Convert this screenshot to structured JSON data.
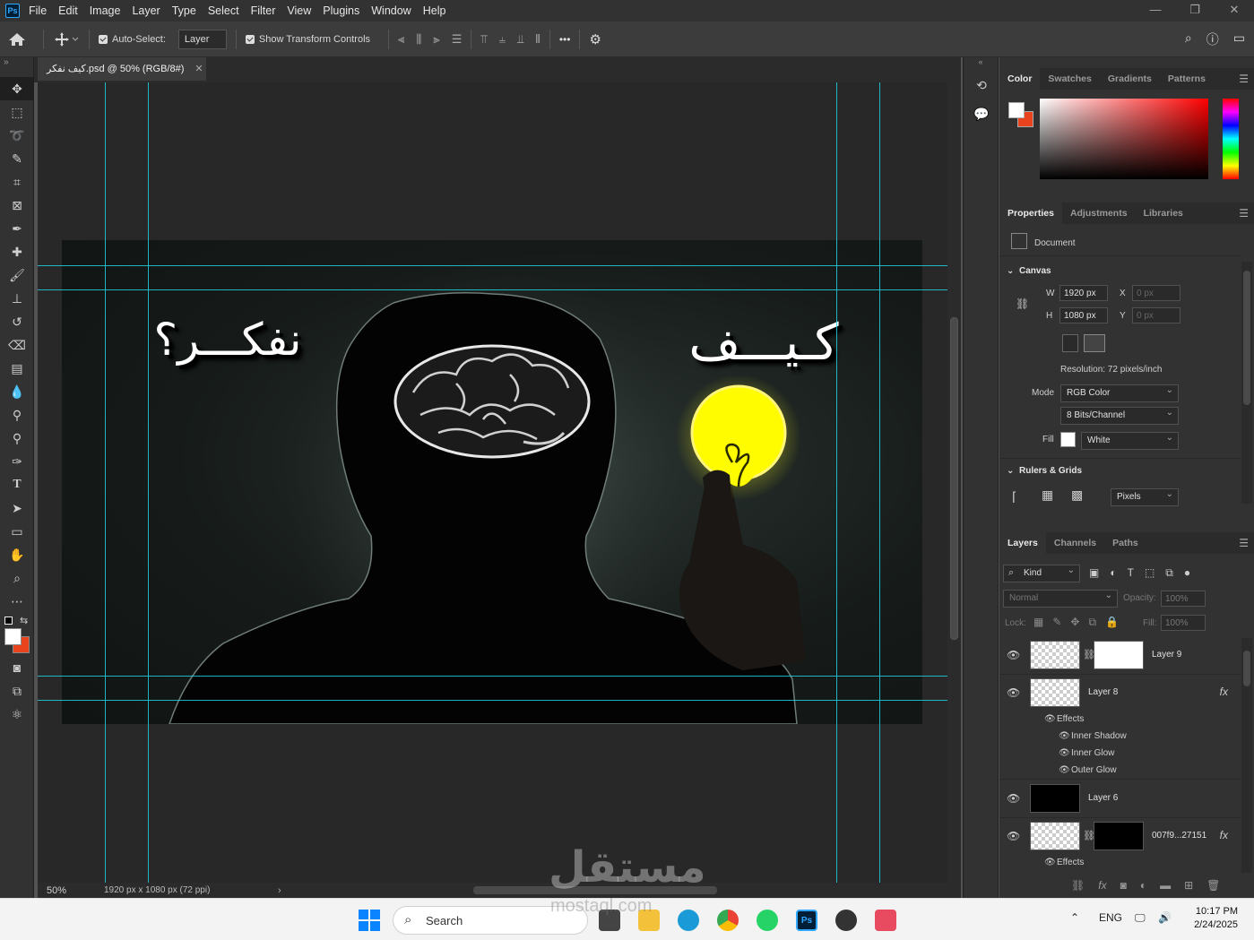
{
  "app": {
    "logo": "Ps",
    "menu": [
      "File",
      "Edit",
      "Image",
      "Layer",
      "Type",
      "Select",
      "Filter",
      "View",
      "Plugins",
      "Window",
      "Help"
    ],
    "window_controls": [
      "—",
      "❐",
      "✕"
    ]
  },
  "options_bar": {
    "auto_select_label": "Auto-Select:",
    "auto_select_target": "Layer",
    "show_transform_label": "Show Transform Controls",
    "more_label": "•••"
  },
  "document": {
    "tab_title": "كيف نفكر.psd @ 50% (RGB/8#)",
    "zoom": "50%",
    "status_info": "1920 px x 1080 px (72 ppi)"
  },
  "artwork": {
    "text_right": "كـيـــف",
    "text_left": "نفكـــر؟"
  },
  "color_panel": {
    "tabs": [
      "Color",
      "Swatches",
      "Gradients",
      "Patterns"
    ],
    "active": "Color",
    "fg": "#ffffff",
    "bg": "#e8431c",
    "hue": "#ff0000"
  },
  "properties_panel": {
    "tabs": [
      "Properties",
      "Adjustments",
      "Libraries"
    ],
    "doc_label": "Document",
    "canvas_title": "Canvas",
    "w_label": "W",
    "w_value": "1920 px",
    "h_label": "H",
    "h_value": "1080 px",
    "x_label": "X",
    "x_value": "0 px",
    "y_label": "Y",
    "y_value": "0 px",
    "resolution": "Resolution: 72 pixels/inch",
    "mode_label": "Mode",
    "mode_value": "RGB Color",
    "bits_value": "8 Bits/Channel",
    "fill_label": "Fill",
    "fill_value": "White",
    "rulers_title": "Rulers & Grids",
    "units_value": "Pixels"
  },
  "layers_panel": {
    "tabs": [
      "Layers",
      "Channels",
      "Paths"
    ],
    "kind_label": "Kind",
    "blend_mode": "Normal",
    "opacity_label": "Opacity:",
    "opacity_value": "100%",
    "lock_label": "Lock:",
    "fill_label": "Fill:",
    "fill_value": "100%",
    "layers": [
      {
        "name": "Layer 9"
      },
      {
        "name": "Layer 8",
        "fx": "fx"
      },
      {
        "name": "Layer 6"
      },
      {
        "name": "007f9...27151",
        "fx": "fx"
      }
    ],
    "effects_label": "Effects",
    "effects": [
      "Inner Shadow",
      "Inner Glow",
      "Outer Glow"
    ],
    "effects_label_2": "Effects"
  },
  "taskbar": {
    "search_placeholder": "Search",
    "lang": "ENG",
    "time": "10:17 PM",
    "date": "2/24/2025"
  },
  "watermark": {
    "arabic": "مستقل",
    "latin": "mostaql.com"
  }
}
